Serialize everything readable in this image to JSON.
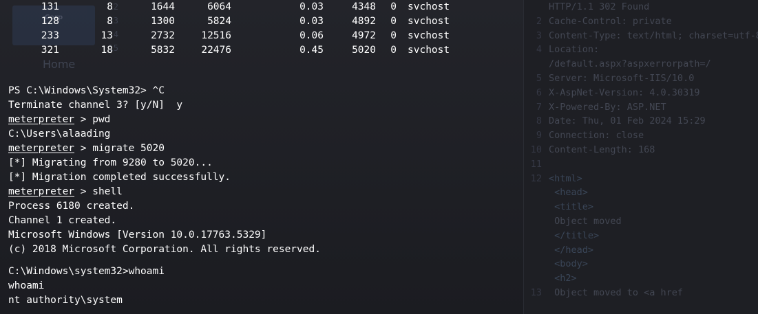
{
  "process_table": {
    "rows": [
      {
        "pid": "131",
        "threads": "8",
        "mem1": "1644",
        "mem2": "6064",
        "cpu": "0.03",
        "id": "4348",
        "session": "0",
        "name": "svchost"
      },
      {
        "pid": "128",
        "threads": "8",
        "mem1": "1300",
        "mem2": "5824",
        "cpu": "0.03",
        "id": "4892",
        "session": "0",
        "name": "svchost"
      },
      {
        "pid": "233",
        "threads": "13",
        "mem1": "2732",
        "mem2": "12516",
        "cpu": "0.06",
        "id": "4972",
        "session": "0",
        "name": "svchost"
      },
      {
        "pid": "321",
        "threads": "18",
        "mem1": "5832",
        "mem2": "22476",
        "cpu": "0.45",
        "id": "5020",
        "session": "0",
        "name": "svchost"
      }
    ]
  },
  "terminal": {
    "ps_prompt": "PS C:\\Windows\\System32> ^C",
    "terminate_question": "Terminate channel 3? [y/N]  y",
    "meterpreter_label": "meterpreter",
    "cmd_pwd": " > pwd",
    "pwd_output": "C:\\Users\\alaading",
    "cmd_migrate": " > migrate 5020",
    "migrate_line1": "[*] Migrating from 9280 to 5020...",
    "migrate_line2": "[*] Migration completed successfully.",
    "cmd_shell": " > shell",
    "process_created": "Process 6180 created.",
    "channel_created": "Channel 1 created.",
    "windows_version": "Microsoft Windows [Version 10.0.17763.5329]",
    "copyright": "(c) 2018 Microsoft Corporation. All rights reserved.",
    "cmd_prompt": "C:\\Windows\\system32>whoami",
    "whoami_echo": "whoami",
    "whoami_result": "nt authority\\system"
  },
  "background": {
    "logo_text": "Corp",
    "home_label": "Home",
    "response_lines": [
      {
        "ln": "",
        "text": "HTTP/1.1 302 Found"
      },
      {
        "ln": "2",
        "text": "Cache-Control: private"
      },
      {
        "ln": "3",
        "text": "Content-Type: text/html; charset=utf-8"
      },
      {
        "ln": "4",
        "text": "Location:"
      },
      {
        "ln": "",
        "text": "/default.aspx?aspxerrorpath=/"
      },
      {
        "ln": "5",
        "text": "Server: Microsoft-IIS/10.0"
      },
      {
        "ln": "6",
        "text": "X-AspNet-Version: 4.0.30319"
      },
      {
        "ln": "7",
        "text": "X-Powered-By: ASP.NET"
      },
      {
        "ln": "8",
        "text": "Date: Thu, 01 Feb 2024 15:29"
      },
      {
        "ln": "9",
        "text": "Connection: close"
      },
      {
        "ln": "10",
        "text": "Content-Length: 168"
      },
      {
        "ln": "11",
        "text": ""
      },
      {
        "ln": "12",
        "text": "<html>"
      },
      {
        "ln": "",
        "text": "  <head>"
      },
      {
        "ln": "",
        "text": "    <title>"
      },
      {
        "ln": "",
        "text": "      Object moved"
      },
      {
        "ln": "",
        "text": "    </title>"
      },
      {
        "ln": "",
        "text": "  </head>"
      },
      {
        "ln": "",
        "text": "  <body>"
      },
      {
        "ln": "",
        "text": "    <h2>"
      },
      {
        "ln": "13",
        "text": "      Object moved to <a href"
      }
    ]
  }
}
